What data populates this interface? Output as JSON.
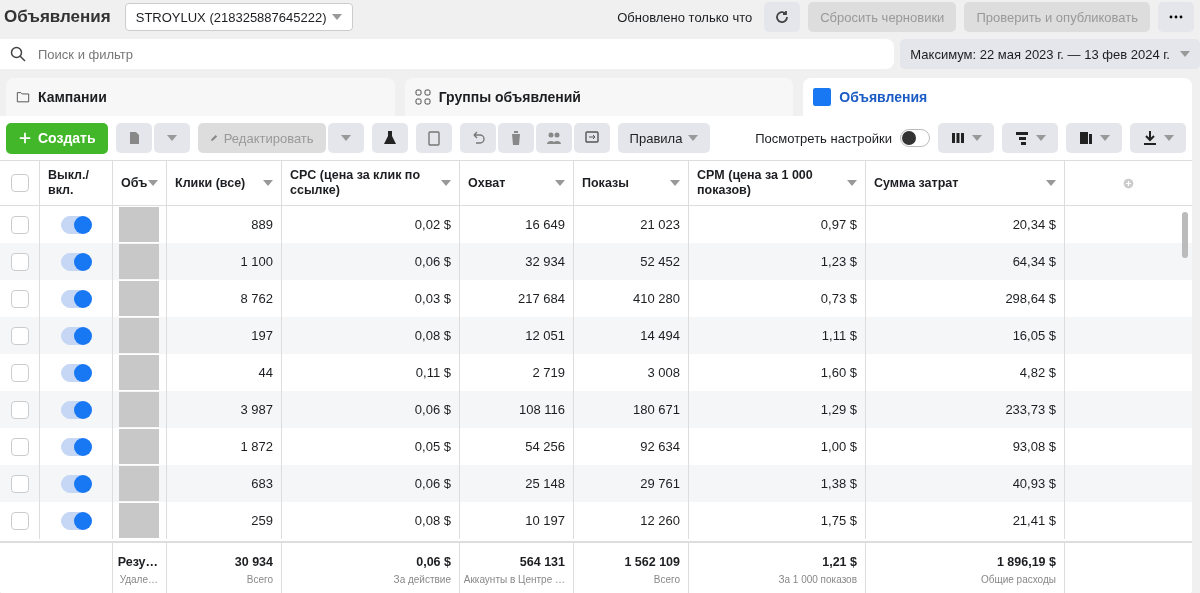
{
  "header": {
    "title": "Объявления",
    "account": "STROYLUX (218325887645222)",
    "updated": "Обновлено только что",
    "reset_button": "Сбросить черновики",
    "publish_button": "Проверить и опубликовать"
  },
  "search": {
    "placeholder": "Поиск и фильтр"
  },
  "date_range": "Максимум: 22 мая 2023 г. — 13 фев 2024 г.",
  "tabs": [
    {
      "label": "Кампании",
      "kind": "folder",
      "selected": false
    },
    {
      "label": "Группы объявлений",
      "kind": "grid",
      "selected": false
    },
    {
      "label": "Объявления",
      "kind": "ad",
      "selected": true
    }
  ],
  "toolbar": {
    "create": "Создать",
    "edit": "Редактировать",
    "rules": "Правила",
    "view_settings": {
      "label": "Посмотреть настройки",
      "on": false
    }
  },
  "table": {
    "select_all_checked": false,
    "columns": [
      "Выкл./ вкл.",
      "Объ",
      "Клики (все)",
      "CPC (цена за клик по ссылке)",
      "Охват",
      "Показы",
      "CPM (цена за 1 000 показов)",
      "Сумма затрат"
    ],
    "rows": [
      {
        "checked": false,
        "on": true,
        "clicks": "889",
        "cpc": "0,02 $",
        "reach": "16 649",
        "impressions": "21 023",
        "cpm": "0,97 $",
        "spend": "20,34 $"
      },
      {
        "checked": false,
        "on": true,
        "clicks": "1 100",
        "cpc": "0,06 $",
        "reach": "32 934",
        "impressions": "52 452",
        "cpm": "1,23 $",
        "spend": "64,34 $"
      },
      {
        "checked": false,
        "on": true,
        "clicks": "8 762",
        "cpc": "0,03 $",
        "reach": "217 684",
        "impressions": "410 280",
        "cpm": "0,73 $",
        "spend": "298,64 $"
      },
      {
        "checked": false,
        "on": true,
        "clicks": "197",
        "cpc": "0,08 $",
        "reach": "12 051",
        "impressions": "14 494",
        "cpm": "1,11 $",
        "spend": "16,05 $"
      },
      {
        "checked": false,
        "on": true,
        "clicks": "44",
        "cpc": "0,11 $",
        "reach": "2 719",
        "impressions": "3 008",
        "cpm": "1,60 $",
        "spend": "4,82 $"
      },
      {
        "checked": false,
        "on": true,
        "clicks": "3 987",
        "cpc": "0,06 $",
        "reach": "108 116",
        "impressions": "180 671",
        "cpm": "1,29 $",
        "spend": "233,73 $"
      },
      {
        "checked": false,
        "on": true,
        "clicks": "1 872",
        "cpc": "0,05 $",
        "reach": "54 256",
        "impressions": "92 634",
        "cpm": "1,00 $",
        "spend": "93,08 $"
      },
      {
        "checked": false,
        "on": true,
        "clicks": "683",
        "cpc": "0,06 $",
        "reach": "25 148",
        "impressions": "29 761",
        "cpm": "1,38 $",
        "spend": "40,93 $"
      },
      {
        "checked": false,
        "on": true,
        "clicks": "259",
        "cpc": "0,08 $",
        "reach": "10 197",
        "impressions": "12 260",
        "cpm": "1,75 $",
        "spend": "21,41 $"
      }
    ],
    "footer": [
      {
        "value": "Резу…",
        "note": "Удале…"
      },
      {
        "value": "30 934",
        "note": "Всего"
      },
      {
        "value": "0,06 $",
        "note": "За действие"
      },
      {
        "value": "564 131",
        "note": "Аккаунты в Центре …"
      },
      {
        "value": "1 562 109",
        "note": "Всего"
      },
      {
        "value": "1,21 $",
        "note": "За 1 000 показов"
      },
      {
        "value": "1 896,19 $",
        "note": "Общие расходы"
      }
    ]
  }
}
